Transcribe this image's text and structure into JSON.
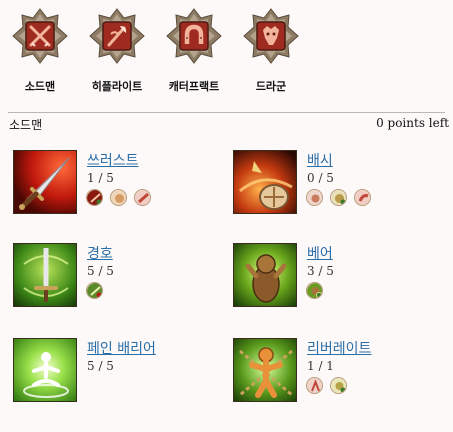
{
  "classes": [
    {
      "name": "소드맨",
      "icon": "crossed-swords-icon"
    },
    {
      "name": "히플라이트",
      "icon": "hoplite-spear-icon"
    },
    {
      "name": "캐터프랙트",
      "icon": "horseshoe-icon"
    },
    {
      "name": "드라군",
      "icon": "dragon-icon"
    }
  ],
  "tree": {
    "title": "소드맨",
    "points_left": "0 points left"
  },
  "skills": [
    {
      "name": "쓰러스트",
      "rank": "1 / 5",
      "icon": "thrust-sword-icon",
      "reqs": 3
    },
    {
      "name": "배시",
      "rank": "0 / 5",
      "icon": "bash-shield-icon",
      "reqs": 3
    },
    {
      "name": "경호",
      "rank": "5 / 5",
      "icon": "guard-sword-icon",
      "reqs": 1
    },
    {
      "name": "베어",
      "rank": "3 / 5",
      "icon": "bear-icon",
      "reqs": 1
    },
    {
      "name": "페인 배리어",
      "rank": "5 / 5",
      "icon": "pain-barrier-icon",
      "reqs": 0
    },
    {
      "name": "리버레이트",
      "rank": "1 / 1",
      "icon": "liberate-icon",
      "reqs": 2
    }
  ],
  "colors": {
    "link": "#2a6ea8",
    "badge_red": "#9e2a20",
    "badge_frame": "#b9a98f"
  }
}
